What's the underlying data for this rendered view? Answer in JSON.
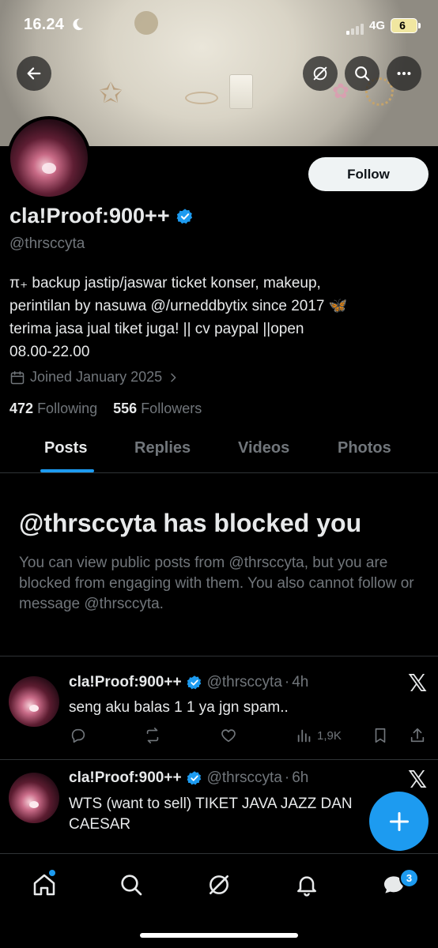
{
  "status_bar": {
    "time": "16.24",
    "network": "4G",
    "battery": "6"
  },
  "profile": {
    "follow_label": "Follow",
    "display_name": "cla!Proof:900++",
    "handle": "@thrsccyta",
    "bio_lines": [
      "π₊ backup jastip/jaswar ticket konser, makeup,",
      "perintilan by nasuwa @/urneddbytix since 2017 🦋",
      "terima jasa jual tiket juga! || cv paypal ||open",
      "08.00-22.00"
    ],
    "joined": "Joined January 2025",
    "following_count": "472",
    "following_label": "Following",
    "followers_count": "556",
    "followers_label": "Followers"
  },
  "tabs": [
    {
      "label": "Posts",
      "active": true
    },
    {
      "label": "Replies",
      "active": false
    },
    {
      "label": "Videos",
      "active": false
    },
    {
      "label": "Photos",
      "active": false
    }
  ],
  "blocked": {
    "title": "@thrsccyta has blocked you",
    "message": "You can view public posts from @thrsccyta, but you are blocked from engaging with them. You also cannot follow or message @thrsccyta."
  },
  "posts": [
    {
      "name": "cla!Proof:900++",
      "handle": "@thrsccyta",
      "time": "4h",
      "text": "seng aku balas 1 1 ya jgn spam..",
      "views": "1,9K"
    },
    {
      "name": "cla!Proof:900++",
      "handle": "@thrsccyta",
      "time": "6h",
      "text_line1": "WTS (want to sell) TIKET JAVA JAZZ DAN",
      "text_line2": "CAESAR"
    }
  ],
  "nav": {
    "messages_badge": "3"
  },
  "colors": {
    "accent": "#1d9bf0",
    "background": "#000000",
    "muted_text": "#71767b",
    "divider": "#2f3336"
  },
  "icons": [
    "back-arrow-icon",
    "grok-icon",
    "search-icon",
    "more-icon",
    "verified-badge-icon",
    "calendar-icon",
    "chevron-right-icon",
    "x-logo-icon",
    "reply-icon",
    "repost-icon",
    "like-icon",
    "views-icon",
    "bookmark-icon",
    "share-icon",
    "plus-icon",
    "home-icon",
    "notifications-icon",
    "messages-icon"
  ]
}
